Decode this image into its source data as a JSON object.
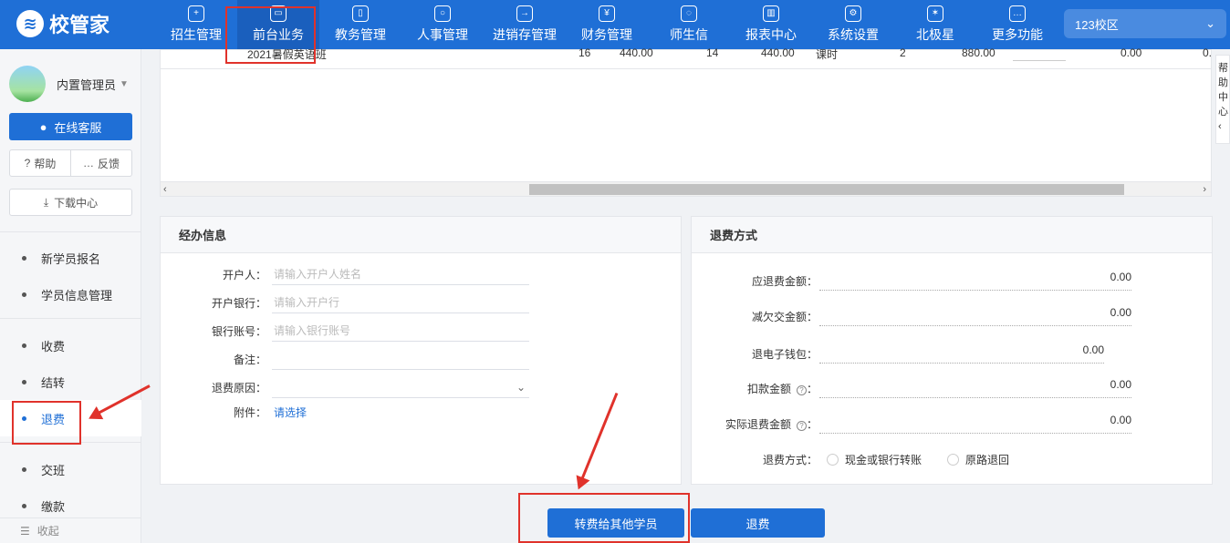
{
  "app": {
    "logo_text": "校管家",
    "campus": "123校区"
  },
  "nav": [
    {
      "label": "招生管理",
      "icon": "user-plus-icon",
      "glyph": "+"
    },
    {
      "label": "前台业务",
      "icon": "front-desk-icon",
      "glyph": "▭"
    },
    {
      "label": "教务管理",
      "icon": "book-icon",
      "glyph": "▯"
    },
    {
      "label": "人事管理",
      "icon": "person-icon",
      "glyph": "○"
    },
    {
      "label": "进销存管理",
      "icon": "inventory-icon",
      "glyph": "→"
    },
    {
      "label": "财务管理",
      "icon": "finance-icon",
      "glyph": "¥"
    },
    {
      "label": "师生信",
      "icon": "chat-icon",
      "glyph": "◌"
    },
    {
      "label": "报表中心",
      "icon": "report-icon",
      "glyph": "▥"
    },
    {
      "label": "系统设置",
      "icon": "settings-icon",
      "glyph": "⚙"
    },
    {
      "label": "北极星",
      "icon": "star-icon",
      "glyph": "✶"
    },
    {
      "label": "更多功能",
      "icon": "more-icon",
      "glyph": "…"
    }
  ],
  "sidebar": {
    "user": "内置管理员",
    "service": "在线客服",
    "help": "帮助",
    "feedback": "反馈",
    "download": "下载中心",
    "group1": [
      "新学员报名",
      "学员信息管理"
    ],
    "group2": [
      "收费",
      "结转",
      "退费"
    ],
    "group3": [
      "交班",
      "缴款"
    ],
    "collapse": "收起"
  },
  "table": {
    "row": {
      "course": "2021暑假英语班",
      "c1": "16",
      "c2": "440.00",
      "c3": "14",
      "c4": "440.00",
      "unit": "课时",
      "c5": "2",
      "c6": "880.00",
      "c7": "0.00",
      "c8": "0."
    }
  },
  "handler_panel": {
    "title": "经办信息",
    "account_holder_label": "开户人：",
    "account_holder_placeholder": "请输入开户人姓名",
    "bank_label": "开户银行：",
    "bank_placeholder": "请输入开户行",
    "account_no_label": "银行账号：",
    "account_no_placeholder": "请输入银行账号",
    "remark_label": "备注：",
    "reason_label": "退费原因：",
    "attach_label": "附件：",
    "attach_link": "请选择"
  },
  "refund_panel": {
    "title": "退费方式",
    "due_label": "应退费金额：",
    "due_value": "0.00",
    "reduce_label": "减欠交金额：",
    "reduce_value": "0.00",
    "wallet_label": "退电子钱包：",
    "wallet_value": "0.00",
    "deduct_label": "扣款金额",
    "deduct_value": "0.00",
    "actual_label": "实际退费金额",
    "actual_value": "0.00",
    "method_label": "退费方式：",
    "option1": "现金或银行转账",
    "option2": "原路退回"
  },
  "actions": {
    "transfer": "转费给其他学员",
    "refund": "退费"
  },
  "float_text": "帮\n助\n中\n心\n‹"
}
